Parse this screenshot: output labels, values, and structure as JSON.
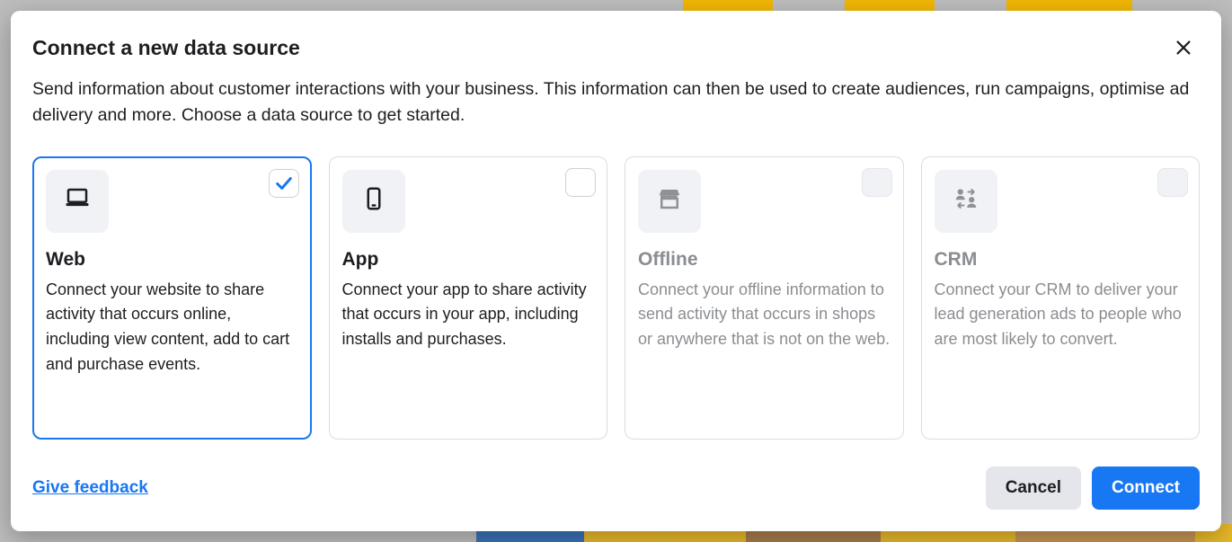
{
  "modal": {
    "title": "Connect a new data source",
    "description": "Send information about customer interactions with your business. This information can then be used to create audiences, run campaigns, optimise ad delivery and more. Choose a data source to get started."
  },
  "options": [
    {
      "id": "web",
      "title": "Web",
      "description": "Connect your website to share activity that occurs online, including view content, add to cart and purchase events.",
      "icon": "laptop-icon",
      "selected": true,
      "enabled": true
    },
    {
      "id": "app",
      "title": "App",
      "description": "Connect your app to share activity that occurs in your app, including installs and purchases.",
      "icon": "mobile-icon",
      "selected": false,
      "enabled": true
    },
    {
      "id": "offline",
      "title": "Offline",
      "description": "Connect your offline information to send activity that occurs in shops or anywhere that is not on the web.",
      "icon": "store-icon",
      "selected": false,
      "enabled": false
    },
    {
      "id": "crm",
      "title": "CRM",
      "description": "Connect your CRM to deliver your lead generation ads to people who are most likely to convert.",
      "icon": "people-sync-icon",
      "selected": false,
      "enabled": false
    }
  ],
  "footer": {
    "feedback_link": "Give feedback",
    "cancel_label": "Cancel",
    "connect_label": "Connect"
  }
}
